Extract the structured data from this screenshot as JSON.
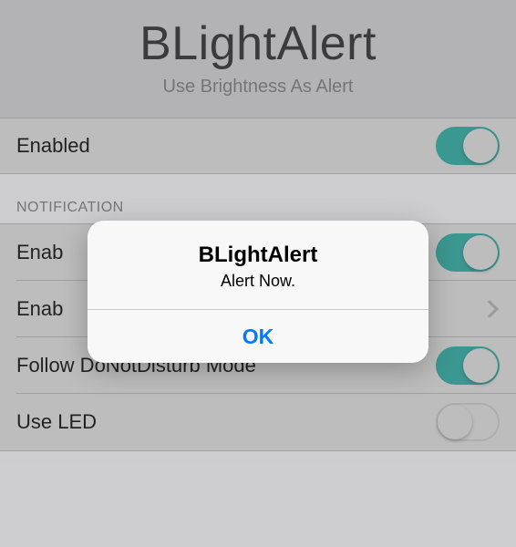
{
  "header": {
    "title": "BLightAlert",
    "subtitle": "Use Brightness As Alert"
  },
  "topRow": {
    "label": "Enabled",
    "switch_on": true
  },
  "sectionHeader": "NOTIFICATION",
  "rows": [
    {
      "label": "Enab",
      "type": "switch",
      "on": true
    },
    {
      "label": "Enab",
      "type": "disclosure"
    },
    {
      "label": "Follow DoNotDisturb Mode",
      "type": "switch",
      "on": true
    },
    {
      "label": "Use LED",
      "type": "switch",
      "on": false
    }
  ],
  "alert": {
    "title": "BLightAlert",
    "message": "Alert Now.",
    "ok": "OK"
  }
}
